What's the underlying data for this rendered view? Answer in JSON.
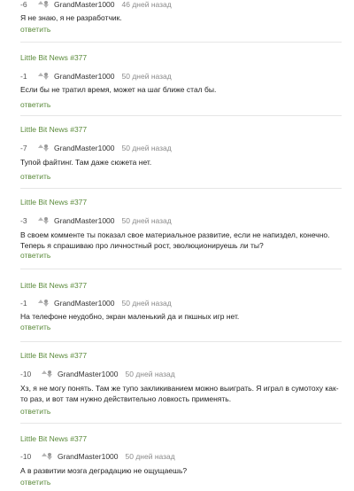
{
  "comments": [
    {
      "post_title": "",
      "rating": "-6",
      "author": "GrandMaster1000",
      "date": "46 дней назад",
      "text": "Я не знаю, я не разработчик.",
      "reply_label": "ответить"
    },
    {
      "post_title": "Little Bit News #377",
      "rating": "-1",
      "author": "GrandMaster1000",
      "date": "50 дней назад",
      "text": "Если бы не тратил время, может на шаг ближе стал бы.",
      "reply_label": "ответить"
    },
    {
      "post_title": "Little Bit News #377",
      "rating": "-7",
      "author": "GrandMaster1000",
      "date": "50 дней назад",
      "text": "Тупой файтинг. Там даже сюжета нет.",
      "reply_label": "ответить"
    },
    {
      "post_title": "Little Bit News #377",
      "rating": "-3",
      "author": "GrandMaster1000",
      "date": "50 дней назад",
      "text": "В своем комменте ты показал свое материальное развитие, если не напиздел, конечно. Теперь я спрашиваю про личностный рост, эволюционируешь ли ты?",
      "reply_label": "ответить"
    },
    {
      "post_title": "Little Bit News #377",
      "rating": "-1",
      "author": "GrandMaster1000",
      "date": "50 дней назад",
      "text": "На телефоне неудобно, экран маленький да и пкшных игр нет.",
      "reply_label": "ответить"
    },
    {
      "post_title": "Little Bit News #377",
      "rating": "-10",
      "author": "GrandMaster1000",
      "date": "50 дней назад",
      "text": "Хз, я не могу понять. Там же тупо закликиванием можно выиграть. Я играл в сумотоху как-то раз, и вот там нужно действительно ловкость применять.",
      "reply_label": "ответить"
    },
    {
      "post_title": "Little Bit News #377",
      "rating": "-10",
      "author": "GrandMaster1000",
      "date": "50 дней назад",
      "text": "А в развитии мозга деградацию не ощущаешь?",
      "reply_label": "ответить"
    }
  ]
}
